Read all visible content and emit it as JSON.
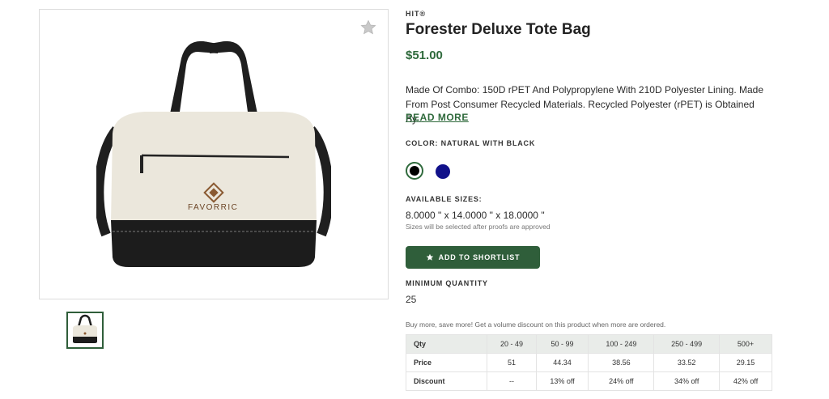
{
  "product": {
    "brand": "HIT®",
    "title": "Forester Deluxe Tote Bag",
    "price": "$51.00",
    "description": "Made Of Combo: 150D rPET And Polypropylene With 210D Polyester Lining. Made From Post Consumer Recycled Materials. Recycled Polyester (rPET) is Obtained By...",
    "read_more": "READ MORE",
    "imprint_logo": "FAVORRIC"
  },
  "color": {
    "label": "COLOR:",
    "selected": "NATURAL WITH BLACK",
    "swatches": [
      {
        "name": "Natural with Black",
        "hex": "#000000"
      },
      {
        "name": "Navy",
        "hex": "#11118a"
      }
    ]
  },
  "sizes": {
    "label": "AVAILABLE SIZES:",
    "value": "8.0000 \" x 14.0000 \" x 18.0000 \"",
    "note": "Sizes will be selected after proofs are approved"
  },
  "shortlist_button": "ADD TO SHORTLIST",
  "min_quantity": {
    "label": "MINIMUM QUANTITY",
    "value": "25"
  },
  "promo_text": "Buy more, save more! Get a volume discount on this product when more are ordered.",
  "volume_table": {
    "header": [
      "Qty",
      "20 - 49",
      "50 - 99",
      "100 - 249",
      "250 - 499",
      "500+"
    ],
    "price": [
      "Price",
      "51",
      "44.34",
      "38.56",
      "33.52",
      "29.15"
    ],
    "discount": [
      "Discount",
      "--",
      "13% off",
      "24% off",
      "34% off",
      "42% off"
    ]
  },
  "colors": {
    "accent": "#2f6a3c",
    "button": "#2f5e3a"
  }
}
